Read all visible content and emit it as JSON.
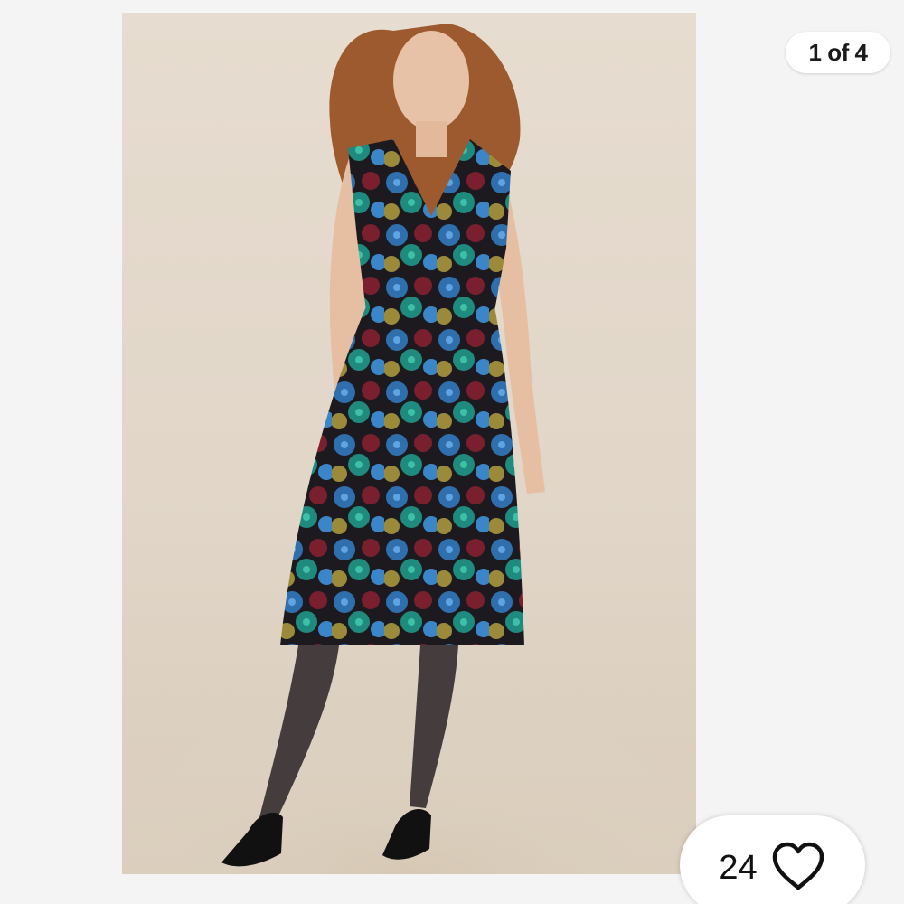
{
  "gallery": {
    "counter_text": "1 of 4",
    "current": 1,
    "total": 4
  },
  "likes": {
    "count": "24",
    "icon": "heart-outline-icon"
  },
  "colors": {
    "background": "#f4f4f4",
    "photo_backdrop": "#e3d8ca",
    "dress_base": "#1c1a1f",
    "sequin_blue": "#2f6fae",
    "sequin_teal": "#1f8a7e",
    "sequin_burgundy": "#7a1f2e",
    "sequin_gold": "#9a8a3a"
  }
}
